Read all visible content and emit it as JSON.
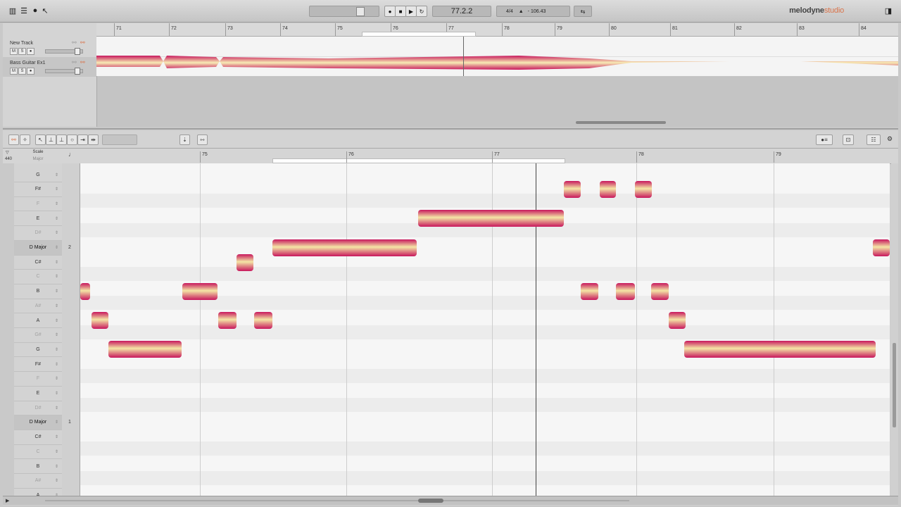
{
  "toolbar": {
    "position": "77.2.2",
    "time_signature": "4/4",
    "tempo": "106.43",
    "brand_main": "melodyne",
    "brand_sub": "studio"
  },
  "tracks": [
    {
      "name": "New Track",
      "m": "M",
      "s": "S"
    },
    {
      "name": "Bass Guitar Ex1",
      "m": "M",
      "s": "S"
    }
  ],
  "arrangement_bars": [
    "71",
    "72",
    "73",
    "74",
    "75",
    "76",
    "77",
    "78",
    "79",
    "80",
    "81",
    "82",
    "83",
    "84"
  ],
  "editor": {
    "bars": [
      "75",
      "76",
      "77",
      "78",
      "79"
    ],
    "scale_header": "Scale",
    "scale_sub": "Major",
    "tuning": "440"
  },
  "scale_rows": [
    {
      "label": "G",
      "dim": false,
      "key": false
    },
    {
      "label": "F#",
      "dim": false,
      "key": false
    },
    {
      "label": "F",
      "dim": true,
      "key": false
    },
    {
      "label": "E",
      "dim": false,
      "key": false
    },
    {
      "label": "D#",
      "dim": true,
      "key": false
    },
    {
      "label": "D Major",
      "dim": false,
      "key": true,
      "num": "2"
    },
    {
      "label": "C#",
      "dim": false,
      "key": false
    },
    {
      "label": "C",
      "dim": true,
      "key": false
    },
    {
      "label": "B",
      "dim": false,
      "key": false
    },
    {
      "label": "A#",
      "dim": true,
      "key": false
    },
    {
      "label": "A",
      "dim": false,
      "key": false
    },
    {
      "label": "G#",
      "dim": true,
      "key": false
    },
    {
      "label": "G",
      "dim": false,
      "key": false
    },
    {
      "label": "F#",
      "dim": false,
      "key": false
    },
    {
      "label": "F",
      "dim": true,
      "key": false
    },
    {
      "label": "E",
      "dim": false,
      "key": false
    },
    {
      "label": "D#",
      "dim": true,
      "key": false
    },
    {
      "label": "D Major",
      "dim": false,
      "key": true,
      "num": "1"
    },
    {
      "label": "C#",
      "dim": false,
      "key": false
    },
    {
      "label": "C",
      "dim": true,
      "key": false
    },
    {
      "label": "B",
      "dim": false,
      "key": false
    },
    {
      "label": "A#",
      "dim": true,
      "key": false
    },
    {
      "label": "A",
      "dim": false,
      "key": false
    }
  ],
  "colors": {
    "blob_outer": "#c8175d",
    "blob_inner": "#f4e6a6",
    "accent": "#d9734a"
  }
}
